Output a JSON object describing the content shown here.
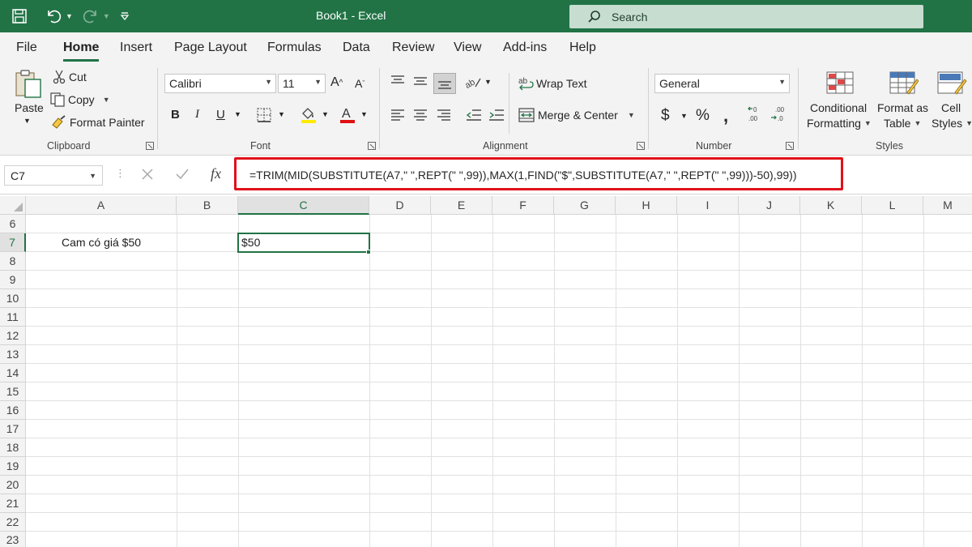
{
  "app": {
    "title": "Book1  -  Excel",
    "search_placeholder": "Search",
    "accent_color": "#217346"
  },
  "tabs": [
    "File",
    "Home",
    "Insert",
    "Page Layout",
    "Formulas",
    "Data",
    "Review",
    "View",
    "Add-ins",
    "Help"
  ],
  "active_tab": "Home",
  "ribbon": {
    "clipboard": {
      "paste": "Paste",
      "cut": "Cut",
      "copy": "Copy",
      "format_painter": "Format Painter",
      "label": "Clipboard"
    },
    "font": {
      "font_name": "Calibri",
      "font_size": "11",
      "label": "Font"
    },
    "alignment": {
      "wrap_text": "Wrap Text",
      "merge_center": "Merge & Center",
      "label": "Alignment"
    },
    "number": {
      "format": "General",
      "label": "Number"
    },
    "styles": {
      "conditional_1": "Conditional",
      "conditional_2": "Formatting",
      "format_as_1": "Format as",
      "format_as_2": "Table",
      "cell_styles_1": "Cell",
      "cell_styles_2": "Styles",
      "label": "Styles"
    }
  },
  "formula_bar": {
    "name_box": "C7",
    "fx_label": "fx",
    "formula": "=TRIM(MID(SUBSTITUTE(A7,\" \",REPT(\" \",99)),MAX(1,FIND(\"$\",SUBSTITUTE(A7,\" \",REPT(\" \",99)))-50),99))"
  },
  "grid": {
    "columns": [
      "A",
      "B",
      "C",
      "D",
      "E",
      "F",
      "G",
      "H",
      "I",
      "J",
      "K",
      "L",
      "M"
    ],
    "rows": [
      "6",
      "7",
      "8",
      "9",
      "10",
      "11",
      "12",
      "13",
      "14",
      "15",
      "16",
      "17",
      "18",
      "19",
      "20",
      "21",
      "22",
      "23"
    ],
    "selected_column": "C",
    "selected_row": "7",
    "cells": {
      "A7": "Cam có giá $50",
      "C7": "$50"
    }
  }
}
